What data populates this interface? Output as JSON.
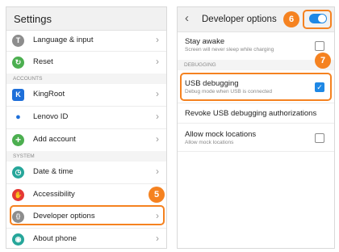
{
  "settings": {
    "title": "Settings",
    "items_top": [
      {
        "label": "Language & input",
        "icon": "language-icon",
        "color": "#8d8d8d",
        "glyph": "T"
      },
      {
        "label": "Reset",
        "icon": "reset-icon",
        "color": "#4caf50",
        "glyph": "↻"
      }
    ],
    "accounts_header": "ACCOUNTS",
    "accounts": [
      {
        "label": "KingRoot",
        "icon": "kingroot-icon",
        "color": "#1e6fd9",
        "glyph": "K"
      },
      {
        "label": "Lenovo ID",
        "icon": "lenovo-id-icon",
        "color": "#ffffff",
        "glyph": "●"
      },
      {
        "label": "Add account",
        "icon": "add-account-icon",
        "color": "#4caf50",
        "glyph": "+"
      }
    ],
    "system_header": "SYSTEM",
    "system": [
      {
        "label": "Date & time",
        "icon": "clock-icon",
        "color": "#26a69a",
        "glyph": "◷"
      },
      {
        "label": "Accessibility",
        "icon": "accessibility-icon",
        "color": "#e53935",
        "glyph": "✋"
      },
      {
        "label": "Developer options",
        "icon": "developer-icon",
        "color": "#8d8d8d",
        "glyph": "{}"
      },
      {
        "label": "About phone",
        "icon": "about-phone-icon",
        "color": "#26a69a",
        "glyph": "◉"
      }
    ],
    "step_badge": "5"
  },
  "developer": {
    "title": "Developer options",
    "back_icon": "back-chevron-icon",
    "toggle_on": true,
    "toggle_badge": "6",
    "stay_awake": {
      "title": "Stay awake",
      "subtitle": "Screen will never sleep while charging",
      "checked": false
    },
    "debugging_header": "DEBUGGING",
    "usb_debugging": {
      "title": "USB debugging",
      "subtitle": "Debug mode when USB is connected",
      "checked": true,
      "badge": "7"
    },
    "revoke": {
      "title": "Revoke USB debugging authorizations"
    },
    "mock_locations": {
      "title": "Allow mock locations",
      "subtitle": "Allow mock locations",
      "checked": false
    }
  },
  "colors": {
    "accent": "#f58220",
    "blue": "#1e88e5"
  }
}
